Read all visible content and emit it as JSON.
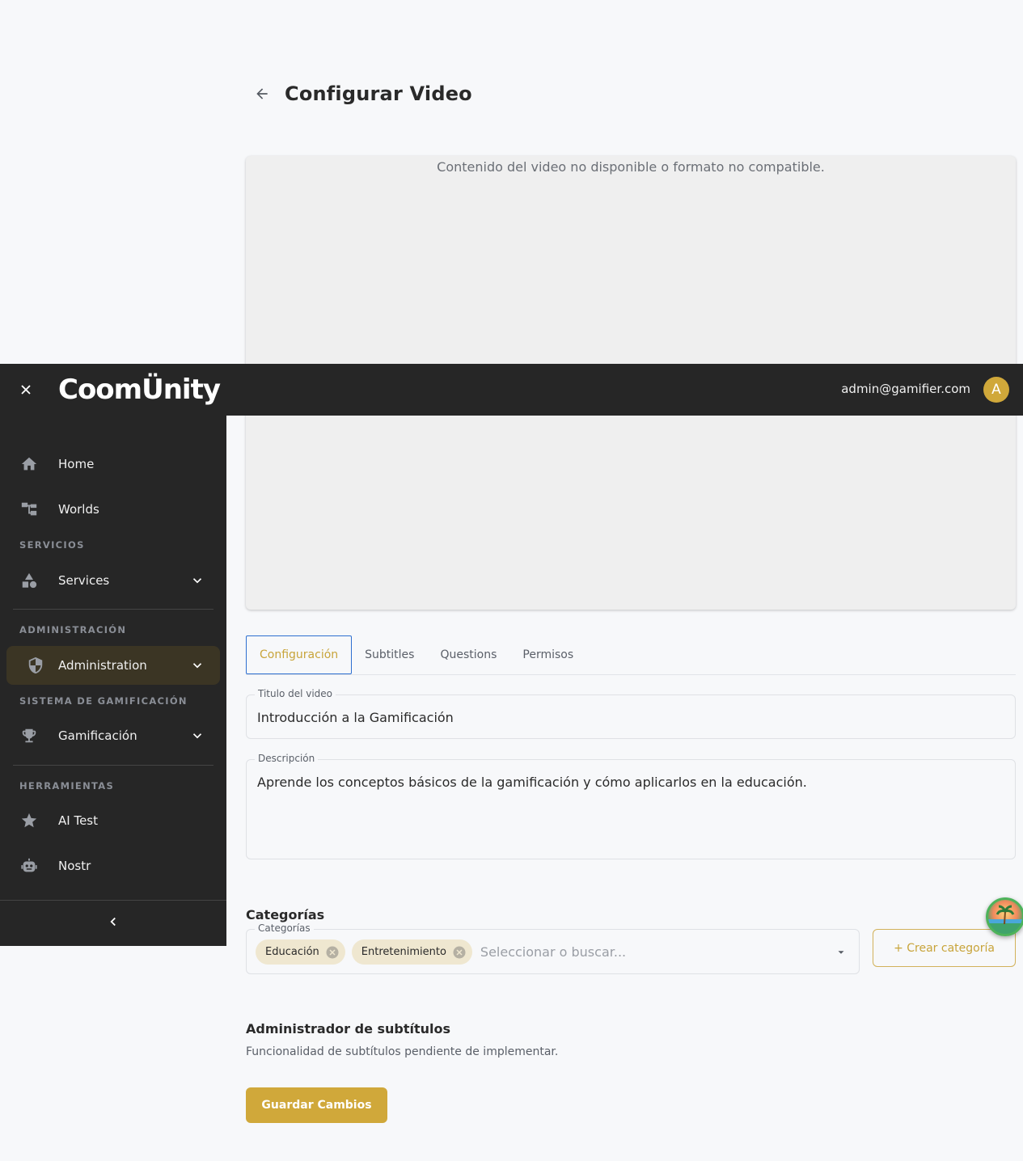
{
  "page": {
    "title": "Configurar Video",
    "video_unavailable": "Contenido del video no disponible o formato no compatible."
  },
  "tabs": [
    {
      "label": "Configuración",
      "active": true
    },
    {
      "label": "Subtitles",
      "active": false
    },
    {
      "label": "Questions",
      "active": false
    },
    {
      "label": "Permisos",
      "active": false
    }
  ],
  "form": {
    "title_label": "Titulo del video",
    "title_value": "Introducción a la Gamificación",
    "description_label": "Descripción",
    "description_value": "Aprende los conceptos básicos de la gamificación y cómo aplicarlos en la educación."
  },
  "categories": {
    "section_title": "Categorías",
    "field_label": "Categorías",
    "chips": [
      "Educación",
      "Entretenimiento"
    ],
    "placeholder": "Seleccionar o buscar...",
    "create_button": "+ Crear categoría"
  },
  "subtitles": {
    "section_title": "Administrador de subtítulos",
    "note": "Funcionalidad de subtítulos pendiente de implementar."
  },
  "save_button": "Guardar Cambios",
  "topbar": {
    "logo_text": "CoomÜnity",
    "user_email": "admin@gamifier.com",
    "user_initial": "A"
  },
  "sidebar": {
    "items": {
      "home": "Home",
      "worlds": "Worlds",
      "services": "Services",
      "administration": "Administration",
      "gamificacion": "Gamificación",
      "ai_test": "AI Test",
      "nostr": "Nostr"
    },
    "headers": {
      "servicios": "SERVICIOS",
      "administracion": "ADMINISTRACIÓN",
      "gamificacion": "SISTEMA DE GAMIFICACIÓN",
      "herramientas": "HERRAMIENTAS"
    }
  },
  "colors": {
    "accent": "#d0a83a",
    "sidebar_bg": "#262626",
    "active_tab_border": "#2e6fd0"
  }
}
